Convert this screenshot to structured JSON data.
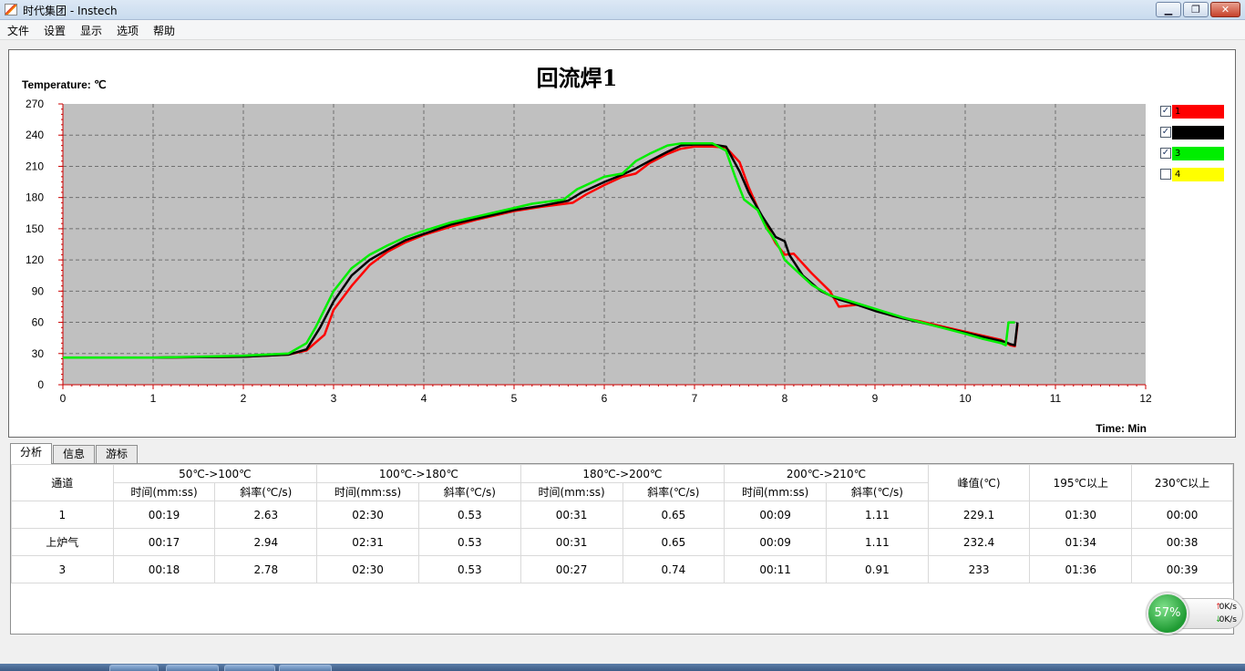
{
  "window": {
    "title": "时代集团 - Instech"
  },
  "menu": [
    "文件",
    "设置",
    "显示",
    "选项",
    "帮助"
  ],
  "chart_data": {
    "type": "line",
    "title": "回流焊1",
    "ylabel": "Temperature: ℃",
    "xlabel": "Time: Min",
    "ylim": [
      0,
      270
    ],
    "xlim": [
      0,
      12
    ],
    "yticks": [
      0,
      30,
      60,
      90,
      120,
      150,
      180,
      210,
      240,
      270
    ],
    "xticks": [
      0,
      1,
      2,
      3,
      4,
      5,
      6,
      7,
      8,
      9,
      10,
      11,
      12
    ],
    "grid": true,
    "legend_position": "right",
    "series": [
      {
        "name": "1",
        "color": "#ff0000",
        "visible": true,
        "x": [
          0,
          1,
          2,
          2.5,
          2.7,
          2.9,
          3.0,
          3.2,
          3.4,
          3.6,
          3.8,
          4.0,
          4.3,
          4.6,
          5.0,
          5.3,
          5.65,
          5.8,
          6.0,
          6.2,
          6.35,
          6.5,
          6.7,
          6.85,
          7.0,
          7.2,
          7.35,
          7.5,
          7.6,
          7.75,
          7.9,
          8.0,
          8.1,
          8.3,
          8.5,
          8.6,
          8.8,
          9.0,
          9.2,
          9.5,
          9.8,
          10.0,
          10.2,
          10.4,
          10.5,
          10.55,
          10.58
        ],
        "y": [
          26,
          26,
          27,
          29,
          33,
          48,
          72,
          95,
          115,
          128,
          137,
          144,
          152,
          159,
          167,
          171,
          175,
          183,
          192,
          200,
          203,
          213,
          222,
          227,
          229,
          229,
          228,
          214,
          190,
          160,
          136,
          125,
          126,
          107,
          90,
          75,
          77,
          72,
          66,
          61,
          55,
          51,
          47,
          43,
          38,
          37,
          58
        ]
      },
      {
        "name": "",
        "color": "#000000",
        "visible": true,
        "x": [
          0,
          1,
          2,
          2.5,
          2.7,
          2.85,
          3.0,
          3.2,
          3.4,
          3.6,
          3.8,
          4.0,
          4.3,
          4.6,
          5.0,
          5.3,
          5.6,
          5.75,
          6.0,
          6.2,
          6.35,
          6.5,
          6.7,
          6.85,
          7.0,
          7.2,
          7.35,
          7.5,
          7.6,
          7.75,
          7.9,
          8.0,
          8.05,
          8.2,
          8.4,
          8.6,
          8.8,
          9.0,
          9.3,
          9.6,
          9.9,
          10.1,
          10.3,
          10.45,
          10.5,
          10.55,
          10.58
        ],
        "y": [
          26,
          26,
          27,
          29,
          34,
          55,
          80,
          105,
          120,
          130,
          139,
          145,
          154,
          160,
          168,
          172,
          177,
          185,
          195,
          202,
          208,
          215,
          224,
          230,
          231,
          231,
          229,
          205,
          185,
          162,
          142,
          138,
          125,
          105,
          90,
          82,
          77,
          71,
          64,
          58,
          52,
          48,
          44,
          41,
          39,
          38,
          60
        ]
      },
      {
        "name": "3",
        "color": "#00ee00",
        "visible": true,
        "x": [
          0,
          1,
          1.5,
          2,
          2.5,
          2.7,
          2.8,
          3.0,
          3.2,
          3.4,
          3.6,
          3.8,
          4.0,
          4.3,
          4.6,
          5.0,
          5.2,
          5.55,
          5.7,
          6.0,
          6.2,
          6.35,
          6.5,
          6.7,
          6.85,
          7.0,
          7.2,
          7.35,
          7.45,
          7.55,
          7.7,
          7.8,
          7.9,
          7.95,
          8.0,
          8.3,
          8.5,
          8.7,
          9.0,
          9.3,
          9.6,
          10.0,
          10.2,
          10.4,
          10.45,
          10.48,
          10.55
        ],
        "y": [
          26,
          26,
          27,
          28,
          30,
          40,
          55,
          90,
          112,
          125,
          134,
          142,
          148,
          156,
          162,
          170,
          174,
          178,
          188,
          200,
          203,
          215,
          222,
          230,
          232,
          232,
          232,
          225,
          200,
          178,
          168,
          150,
          138,
          130,
          120,
          96,
          86,
          81,
          73,
          65,
          58,
          49,
          44,
          40,
          38,
          60,
          60
        ]
      },
      {
        "name": "4",
        "color": "#ffff00",
        "visible": false,
        "x": [],
        "y": []
      }
    ]
  },
  "legend": [
    {
      "label": "1",
      "color": "#ff0000",
      "checked": true,
      "check_glyph": "✓"
    },
    {
      "label": "",
      "color": "#000000",
      "checked": true,
      "check_glyph": "✓"
    },
    {
      "label": "3",
      "color": "#00ee00",
      "checked": true,
      "check_glyph": "✓"
    },
    {
      "label": "4",
      "color": "#ffff00",
      "checked": false,
      "check_glyph": ""
    }
  ],
  "tabs": [
    "分析",
    "信息",
    "游标"
  ],
  "table": {
    "channel_header": "通道",
    "groups": [
      "50℃->100℃",
      "100℃->180℃",
      "180℃->200℃",
      "200℃->210℃"
    ],
    "sub_time": "时间(mm:ss)",
    "sub_slope": "斜率(℃/s)",
    "peak_header": "峰值(℃)",
    "above195_header": "195℃以上",
    "above230_header": "230℃以上",
    "rows": [
      [
        "1",
        "00:19",
        "2.63",
        "02:30",
        "0.53",
        "00:31",
        "0.65",
        "00:09",
        "1.11",
        "229.1",
        "01:30",
        "00:00"
      ],
      [
        "上炉气",
        "00:17",
        "2.94",
        "02:31",
        "0.53",
        "00:31",
        "0.65",
        "00:09",
        "1.11",
        "232.4",
        "01:34",
        "00:38"
      ],
      [
        "3",
        "00:18",
        "2.78",
        "02:30",
        "0.53",
        "00:27",
        "0.74",
        "00:11",
        "0.91",
        "233",
        "01:36",
        "00:39"
      ]
    ]
  },
  "net_widget": {
    "percent": "57%",
    "up_arrow": "↑",
    "down_arrow": "↓",
    "up": "0K/s",
    "down": "0K/s"
  },
  "titlebar_buttons": {
    "minimize": "▁",
    "maximize": "❐",
    "close": "✕"
  }
}
